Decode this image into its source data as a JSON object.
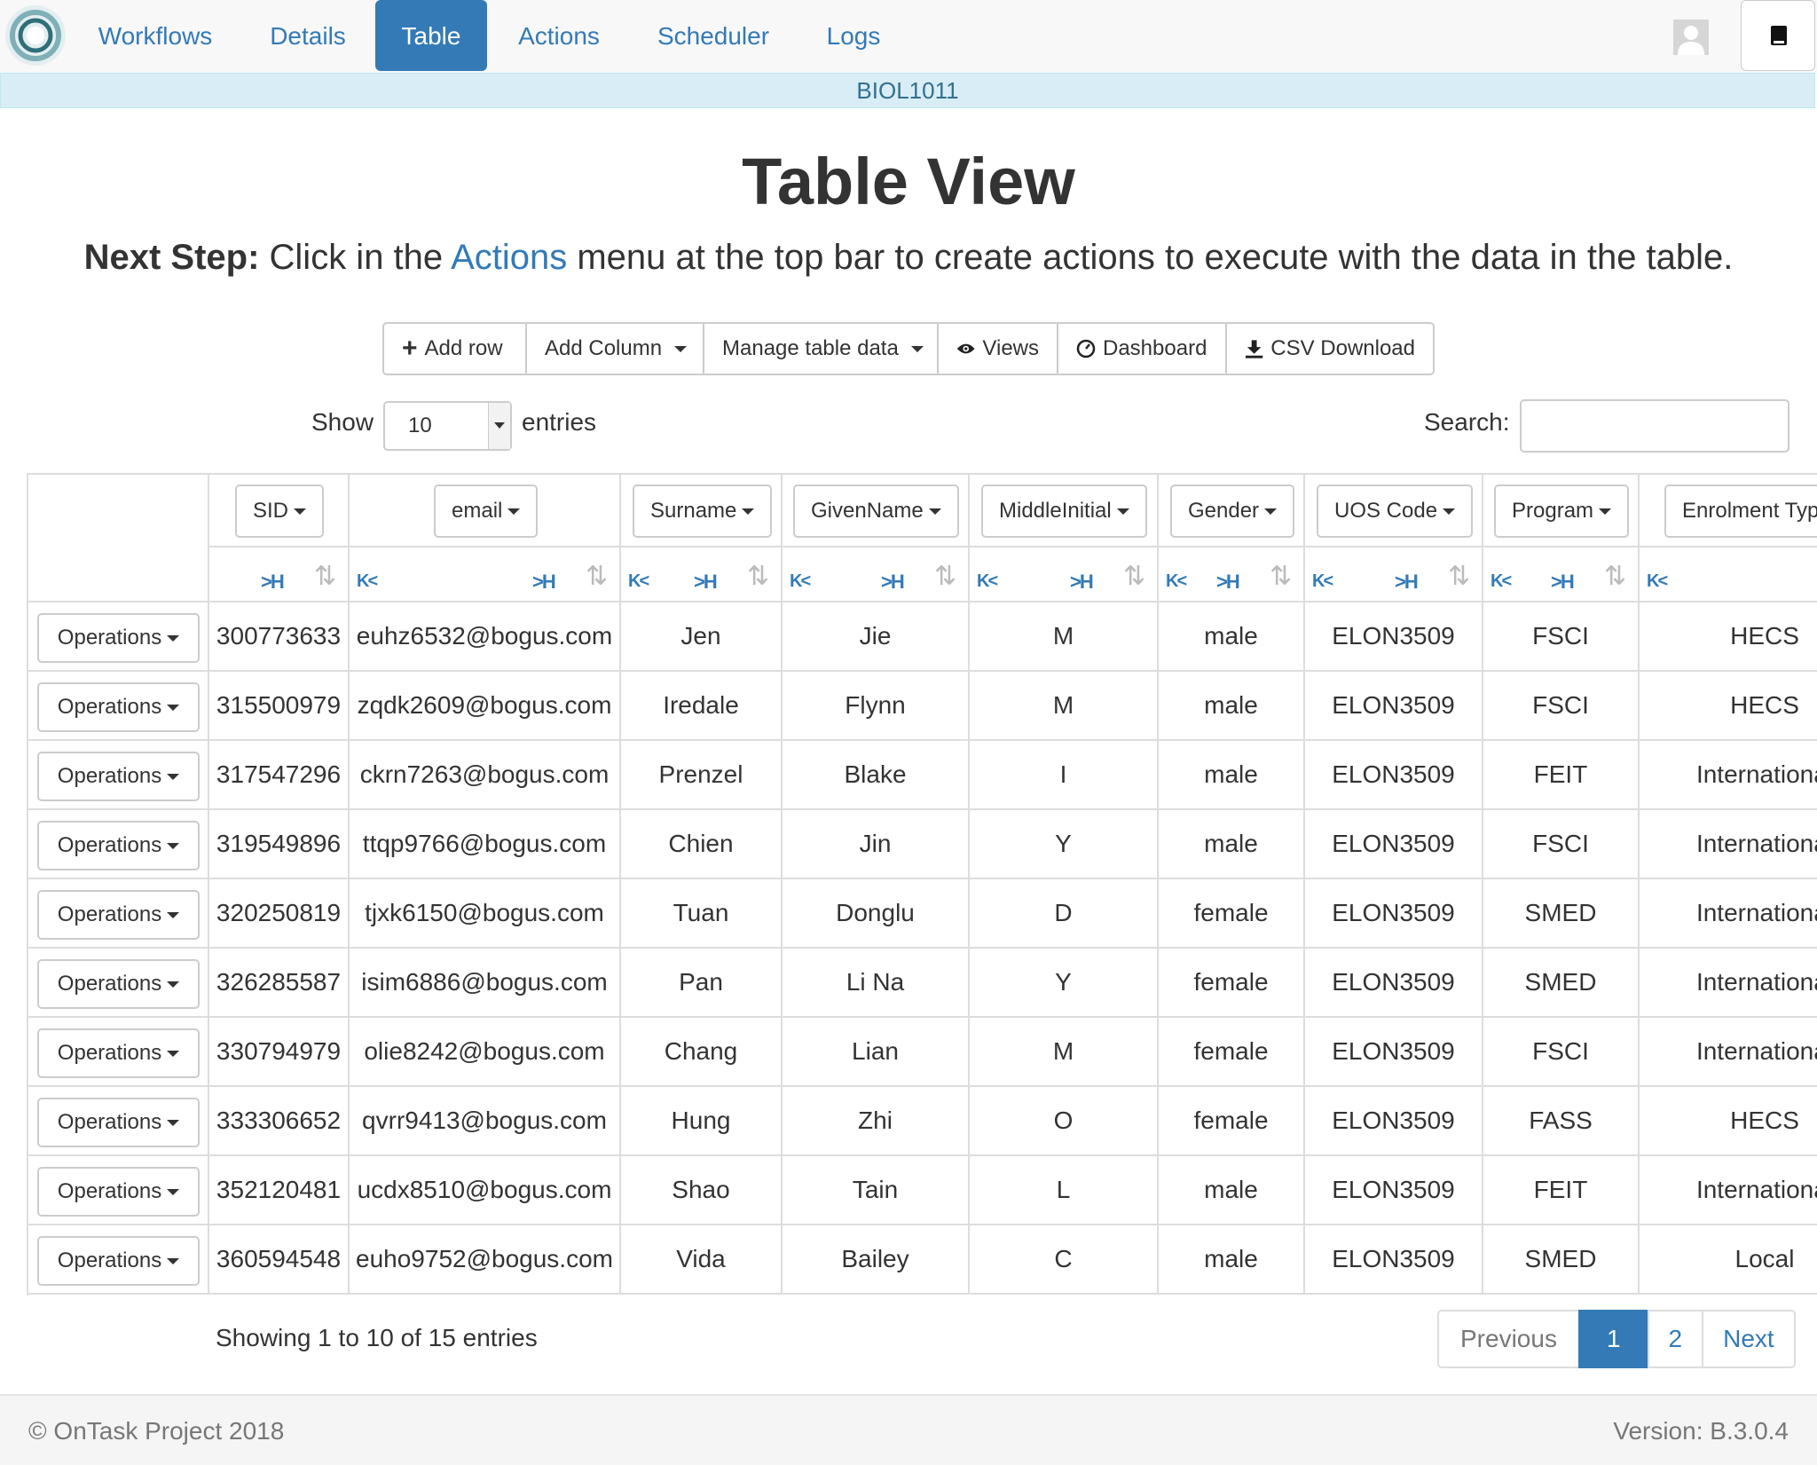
{
  "nav": {
    "items": [
      {
        "label": "Workflows",
        "active": false
      },
      {
        "label": "Details",
        "active": false
      },
      {
        "label": "Table",
        "active": true
      },
      {
        "label": "Actions",
        "active": false
      },
      {
        "label": "Scheduler",
        "active": false
      },
      {
        "label": "Logs",
        "active": false
      }
    ],
    "course": "BIOL1011"
  },
  "page": {
    "title": "Table View",
    "next_step_bold": "Next Step:",
    "next_step_pre": "Click in the",
    "next_step_link": "Actions",
    "next_step_post": "menu at the top bar to create actions to execute with the data in the table."
  },
  "toolbar": {
    "add_row": "Add row",
    "add_column": "Add Column",
    "manage": "Manage table data",
    "views": "Views",
    "dashboard": "Dashboard",
    "csv": "CSV Download"
  },
  "length": {
    "show": "Show",
    "value": "10",
    "entries": "entries"
  },
  "search": {
    "label": "Search:",
    "value": ""
  },
  "table": {
    "columns": [
      "SID",
      "email",
      "Surname",
      "GivenName",
      "MiddleInitial",
      "Gender",
      "UOS Code",
      "Program",
      "Enrolment Type"
    ],
    "operations_label": "Operations",
    "rows": [
      [
        "300773633",
        "euhz6532@bogus.com",
        "Jen",
        "Jie",
        "M",
        "male",
        "ELON3509",
        "FSCI",
        "HECS"
      ],
      [
        "315500979",
        "zqdk2609@bogus.com",
        "Iredale",
        "Flynn",
        "M",
        "male",
        "ELON3509",
        "FSCI",
        "HECS"
      ],
      [
        "317547296",
        "ckrn7263@bogus.com",
        "Prenzel",
        "Blake",
        "I",
        "male",
        "ELON3509",
        "FEIT",
        "International"
      ],
      [
        "319549896",
        "ttqp9766@bogus.com",
        "Chien",
        "Jin",
        "Y",
        "male",
        "ELON3509",
        "FSCI",
        "International"
      ],
      [
        "320250819",
        "tjxk6150@bogus.com",
        "Tuan",
        "Donglu",
        "D",
        "female",
        "ELON3509",
        "SMED",
        "International"
      ],
      [
        "326285587",
        "isim6886@bogus.com",
        "Pan",
        "Li Na",
        "Y",
        "female",
        "ELON3509",
        "SMED",
        "International"
      ],
      [
        "330794979",
        "olie8242@bogus.com",
        "Chang",
        "Lian",
        "M",
        "female",
        "ELON3509",
        "FSCI",
        "International"
      ],
      [
        "333306652",
        "qvrr9413@bogus.com",
        "Hung",
        "Zhi",
        "O",
        "female",
        "ELON3509",
        "FASS",
        "HECS"
      ],
      [
        "352120481",
        "ucdx8510@bogus.com",
        "Shao",
        "Tain",
        "L",
        "male",
        "ELON3509",
        "FEIT",
        "International"
      ],
      [
        "360594548",
        "euho9752@bogus.com",
        "Vida",
        "Bailey",
        "C",
        "male",
        "ELON3509",
        "SMED",
        "Local"
      ]
    ]
  },
  "info": "Showing 1 to 10 of 15 entries",
  "pagination": {
    "previous": "Previous",
    "pages": [
      "1",
      "2"
    ],
    "current": "1",
    "next": "Next"
  },
  "footer": {
    "copyright": "© OnTask Project 2018",
    "version": "Version: B.3.0.4"
  },
  "colors": {
    "primary": "#337ab7",
    "course_bar": "#d9edf7",
    "border": "#dddddd"
  }
}
